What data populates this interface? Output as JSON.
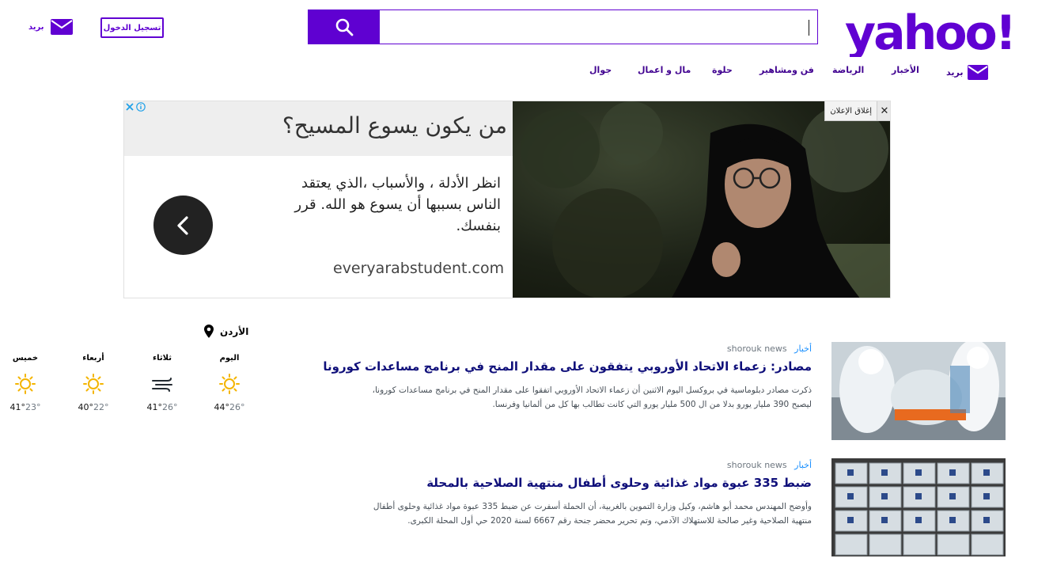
{
  "header": {
    "logo_text": "yahoo!",
    "search": {
      "value": "",
      "placeholder": ""
    },
    "signin_label": "تسجيل الدخول",
    "mail_label": "بريد"
  },
  "nav": {
    "mail_label": "بريد",
    "items": [
      "الأخبار",
      "الرياضة",
      "فن ومشاهير",
      "حلوة",
      "مال و اعمال",
      "جوال"
    ]
  },
  "ad": {
    "headline": "من يكون يسوع المسيح؟",
    "body": "انظر الأدلة ، والأسباب ،الذي يعتقد الناس بسببها أن يسوع هو الله. قرر بنفسك.",
    "url": "everyarabstudent.com",
    "close_label": "إغلاق الإعلان"
  },
  "weather": {
    "location": "الأردن",
    "days": [
      {
        "day": "اليوم",
        "icon": "sun-icon",
        "high": "44°",
        "low": "26°"
      },
      {
        "day": "ثلاثاء",
        "icon": "wind-icon",
        "high": "41°",
        "low": "26°"
      },
      {
        "day": "أربعاء",
        "icon": "sun-icon",
        "high": "40°",
        "low": "22°"
      },
      {
        "day": "خميس",
        "icon": "sun-icon",
        "high": "41°",
        "low": "23°"
      }
    ]
  },
  "news": [
    {
      "category": "أخبار",
      "source": "shorouk news",
      "title": "مصادر: زعماء الاتحاد الأوروبي يتفقون على مقدار المنح في برنامج مساعدات كورونا",
      "summary": "ذكرت مصادر دبلوماسية في بروكسل اليوم الاثنين أن زعماء الاتحاد الأوروبي اتفقوا على مقدار المنح في برنامج مساعدات كورونا، ليصبح 390 مليار يورو بدلا من ال 500 مليار يورو التي كانت تطالب بها كل من ألمانيا وفرنسا."
    },
    {
      "category": "أخبار",
      "source": "shorouk news",
      "title": "ضبط 335 عبوة مواد غذائية وحلوى أطفال منتهية الصلاحية بالمحلة",
      "summary": "وأوضح المهندس محمد أبو هاشم، وكيل وزارة التموين بالغربية، أن الحملة أسفرت عن ضبط 335 عبوة مواد غذائية وحلوى أطفال منتهية الصلاحية وغير صالحة للاستهلاك الآدمي، وتم تحرير محضر جنحة رقم 6667 لسنة 2020 حي أول المحلة الكبرى."
    }
  ],
  "colors": {
    "brand": "#6001d2",
    "headline": "#0f0f7a",
    "category": "#188fff"
  }
}
